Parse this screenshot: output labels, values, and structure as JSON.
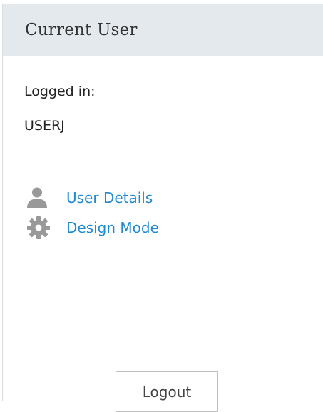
{
  "panel": {
    "title": "Current User"
  },
  "user": {
    "logged_in_label": "Logged in:",
    "username": "USERJ"
  },
  "links": [
    {
      "label": "User Details",
      "icon": "user-icon"
    },
    {
      "label": "Design Mode",
      "icon": "gear-icon"
    }
  ],
  "actions": {
    "logout_label": "Logout"
  },
  "colors": {
    "header_bg": "#e3e9ec",
    "link": "#1f8ad2",
    "icon": "#999999"
  }
}
